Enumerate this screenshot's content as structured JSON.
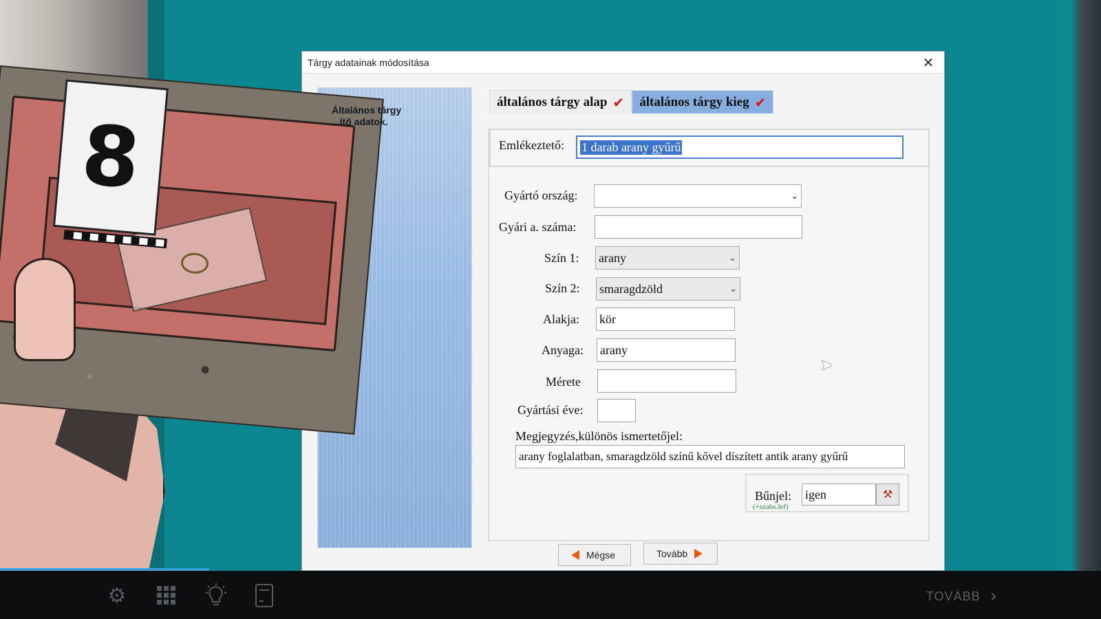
{
  "dialog": {
    "title": "Tárgy adatainak módosítása",
    "close_glyph": "✕",
    "side_text": "Általános tárgy\n...ítő adatok.",
    "tabs": [
      {
        "label": "általános tárgy alap",
        "check": "✔"
      },
      {
        "label": "általános tárgy kieg",
        "check": "✔"
      }
    ],
    "memo_label": "Emlékeztető:",
    "memo_value": "1 darab arany gyűrű",
    "fields": {
      "country_label": "Gyártó ország:",
      "country_value": "",
      "serial_label": "Gyári  a. száma:",
      "serial_value": "",
      "color1_label": "Szín 1:",
      "color1_value": "arany",
      "color2_label": "Szín 2:",
      "color2_value": "smaragdzöld",
      "shape_label": "Alakja:",
      "shape_value": "kör",
      "material_label": "Anyaga:",
      "material_value": "arany",
      "size_label": "Mérete",
      "size_value": "",
      "year_label": "Gyártási éve:",
      "year_value": ""
    },
    "note_label": "Megjegyzés,különös ismertetőjel:",
    "note_value": "arany foglalatban, smaragdzöld színű kővel díszített antik arany gyűrű",
    "evidence_label": "Bűnjel:",
    "evidence_sub": "(+szabs.lef)",
    "evidence_value": "igen",
    "cancel_label": "Mégse",
    "next_label": "Tovább"
  },
  "photo": {
    "marker_number": "8"
  },
  "bottom_bar": {
    "icons": [
      "gear-icon",
      "grid-icon",
      "lightbulb-icon",
      "notebook-icon"
    ],
    "next_label": "TOVÁBB",
    "progress": 0.19
  },
  "colors": {
    "background": "#0a8790",
    "tab_active": "#87aedf",
    "check": "#d21616",
    "progress": "#3ba0d8"
  }
}
